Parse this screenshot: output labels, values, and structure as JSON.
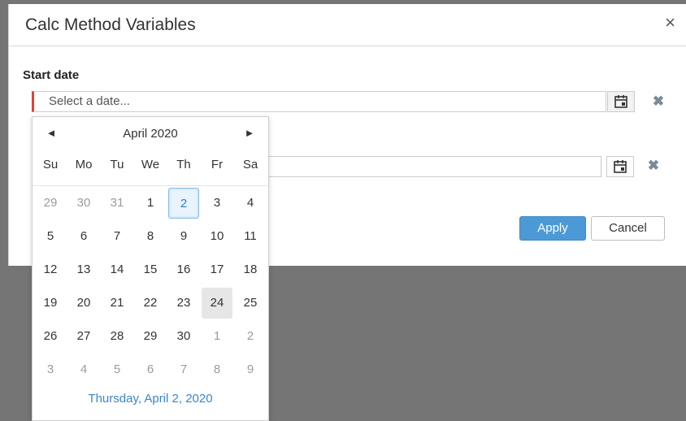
{
  "dialog": {
    "title": "Calc Method Variables",
    "close_glyph": "×"
  },
  "form": {
    "start_date": {
      "label": "Start date",
      "placeholder": "Select a date...",
      "value": ""
    },
    "second_date": {
      "value": ""
    },
    "clear_glyph": "✖"
  },
  "buttons": {
    "apply": "Apply",
    "cancel": "Cancel"
  },
  "datepicker": {
    "month_label": "April 2020",
    "prev_glyph": "◄",
    "next_glyph": "►",
    "weekdays": [
      "Su",
      "Mo",
      "Tu",
      "We",
      "Th",
      "Fr",
      "Sa"
    ],
    "weeks": [
      [
        "29",
        "30",
        "31",
        "1",
        "2",
        "3",
        "4"
      ],
      [
        "5",
        "6",
        "7",
        "8",
        "9",
        "10",
        "11"
      ],
      [
        "12",
        "13",
        "14",
        "15",
        "16",
        "17",
        "18"
      ],
      [
        "19",
        "20",
        "21",
        "22",
        "23",
        "24",
        "25"
      ],
      [
        "26",
        "27",
        "28",
        "29",
        "30",
        "1",
        "2"
      ],
      [
        "3",
        "4",
        "5",
        "6",
        "7",
        "8",
        "9"
      ]
    ],
    "today_label": "Thursday, April 2, 2020"
  },
  "colors": {
    "accent": "#4b9ad6",
    "required_marker": "#e0413a",
    "today_text": "#2f7fc1",
    "backdrop": "#757575"
  },
  "icons": {
    "calendar": "calendar-icon",
    "close": "close-icon",
    "clear": "clear-icon"
  }
}
